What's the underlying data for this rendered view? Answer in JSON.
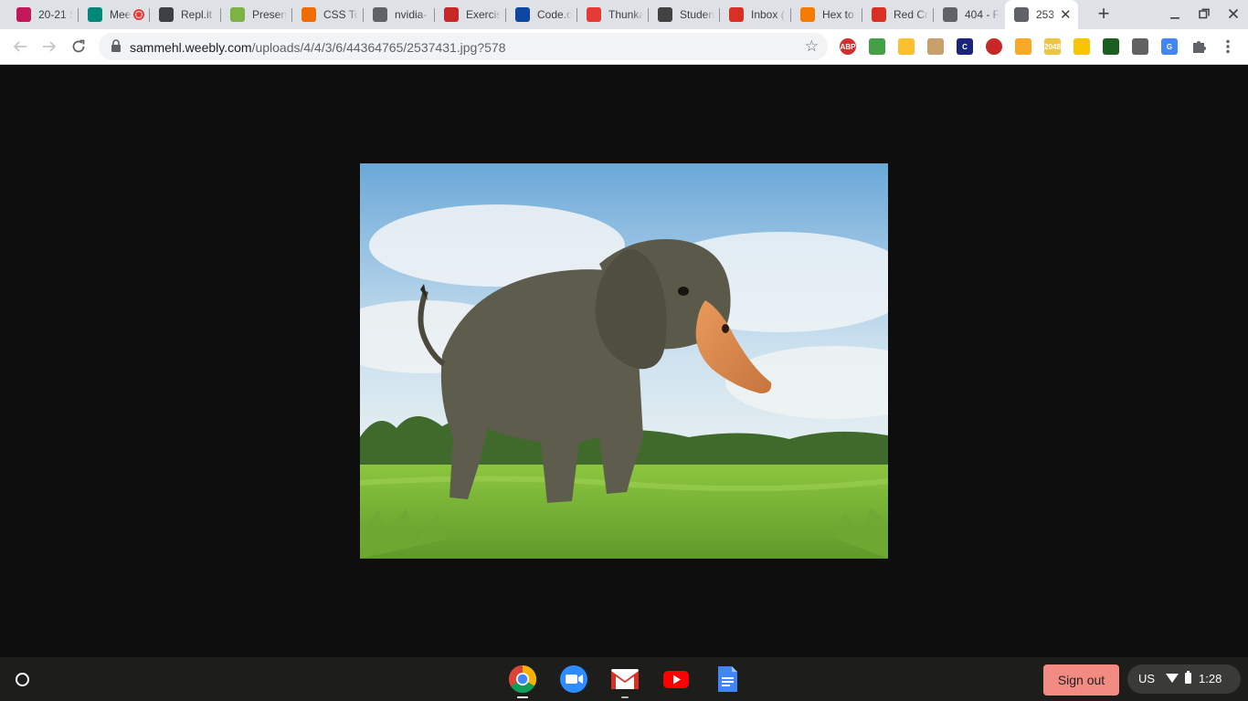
{
  "browser": {
    "tabs": [
      {
        "label": "20-21 S",
        "icon": "classroom-icon",
        "color": "#c2185b"
      },
      {
        "label": "Mee",
        "icon": "meet-icon",
        "color": "#00897b",
        "recording": true
      },
      {
        "label": "Repl.it -",
        "icon": "replit-icon",
        "color": "#3c4043"
      },
      {
        "label": "Present",
        "icon": "pear-deck-icon",
        "color": "#7cb342"
      },
      {
        "label": "CSS To",
        "icon": "tiger-icon",
        "color": "#ef6c00"
      },
      {
        "label": "nvidia-",
        "icon": "globe-icon",
        "color": "#5f6368"
      },
      {
        "label": "Exercis",
        "icon": "codecombat-icon",
        "color": "#c62828"
      },
      {
        "label": "Code.o",
        "icon": "code-org-icon",
        "color": "#0d47a1"
      },
      {
        "label": "Thunka",
        "icon": "thunkable-icon",
        "color": "#e53935"
      },
      {
        "label": "Studen",
        "icon": "weebly-icon",
        "color": "#424242"
      },
      {
        "label": "Inbox (",
        "icon": "gmail-icon",
        "color": "#d93025"
      },
      {
        "label": "Hex to",
        "icon": "rapidtables-icon",
        "color": "#f57c00"
      },
      {
        "label": "Red Cr",
        "icon": "gmail-icon",
        "color": "#d93025"
      },
      {
        "label": "404 - F",
        "icon": "globe-icon",
        "color": "#5f6368"
      },
      {
        "label": "253",
        "icon": "globe-icon",
        "color": "#5f6368",
        "active": true
      }
    ],
    "url": {
      "host": "sammehl.weebly.com",
      "path": "/uploads/4/4/3/6/44364765/2537431.jpg?578"
    },
    "extensions": [
      {
        "name": "adblock-plus-icon",
        "text": "ABP",
        "color": "#d32f2f"
      },
      {
        "name": "printer-friendly-icon",
        "text": "",
        "color": "#43a047"
      },
      {
        "name": "tab-resize-icon",
        "text": "",
        "color": "#fbc02d"
      },
      {
        "name": "doge-icon",
        "text": "",
        "color": "#c8a06b"
      },
      {
        "name": "c-extension-icon",
        "text": "C",
        "color": "#1a237e"
      },
      {
        "name": "red-circle-extension-icon",
        "text": "",
        "color": "#c62828"
      },
      {
        "name": "classroom-share-icon",
        "text": "",
        "color": "#f9a825"
      },
      {
        "name": "game-2048-icon",
        "text": "2048",
        "color": "#edc53f"
      },
      {
        "name": "yellow-extension-icon",
        "text": "",
        "color": "#f9c400"
      },
      {
        "name": "matrix-icon",
        "text": "",
        "color": "#1b5e20"
      },
      {
        "name": "rocket-icon",
        "text": "",
        "color": "#616161"
      },
      {
        "name": "google-translate-icon",
        "text": "G",
        "color": "#4285f4"
      }
    ]
  },
  "shelf": {
    "apps": [
      {
        "name": "chrome-app-icon",
        "active": true
      },
      {
        "name": "zoom-app-icon",
        "active": false
      },
      {
        "name": "gmail-app-icon",
        "active": true
      },
      {
        "name": "youtube-app-icon",
        "active": false
      },
      {
        "name": "docs-app-icon",
        "active": false
      }
    ],
    "sign_out_label": "Sign out",
    "ime": "US",
    "time": "1:28"
  },
  "colors": {
    "tab_strip": "#dee1e6",
    "page_background": "#0e0e0e",
    "shelf": "#1d1d1c",
    "sign_out": "#f28b82"
  }
}
